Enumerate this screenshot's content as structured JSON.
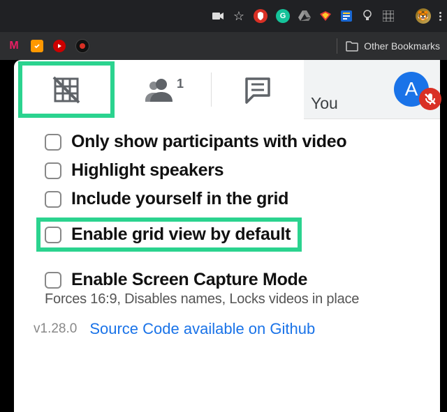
{
  "browser": {
    "bookmarks_label": "Other Bookmarks",
    "ext_colors": {
      "adblock": "#d93025",
      "grammarly": "#15c39a",
      "drive": "#888",
      "brave": "#e53935",
      "reader": "#1967d2",
      "bulb": "#555",
      "grid": "#555"
    },
    "avatar_img": "🧑"
  },
  "bookmarks": {
    "m": "M",
    "m_color": "#e91e63",
    "y_color": "#ff9800",
    "yt_color": "#cc0000",
    "dark_color": "#222"
  },
  "tabs": {
    "you_label": "You",
    "avatar_letter": "A",
    "people_badge": "1"
  },
  "options": [
    {
      "label": "Only show participants with video"
    },
    {
      "label": "Highlight speakers"
    },
    {
      "label": "Include yourself in the grid"
    },
    {
      "label": "Enable grid view by default",
      "highlight": true
    },
    {
      "label": "Enable Screen Capture Mode",
      "sub": "Forces 16:9, Disables names, Locks videos in place",
      "gap_before": true
    }
  ],
  "footer": {
    "version": "v1.28.0",
    "link": "Source Code available on Github"
  }
}
